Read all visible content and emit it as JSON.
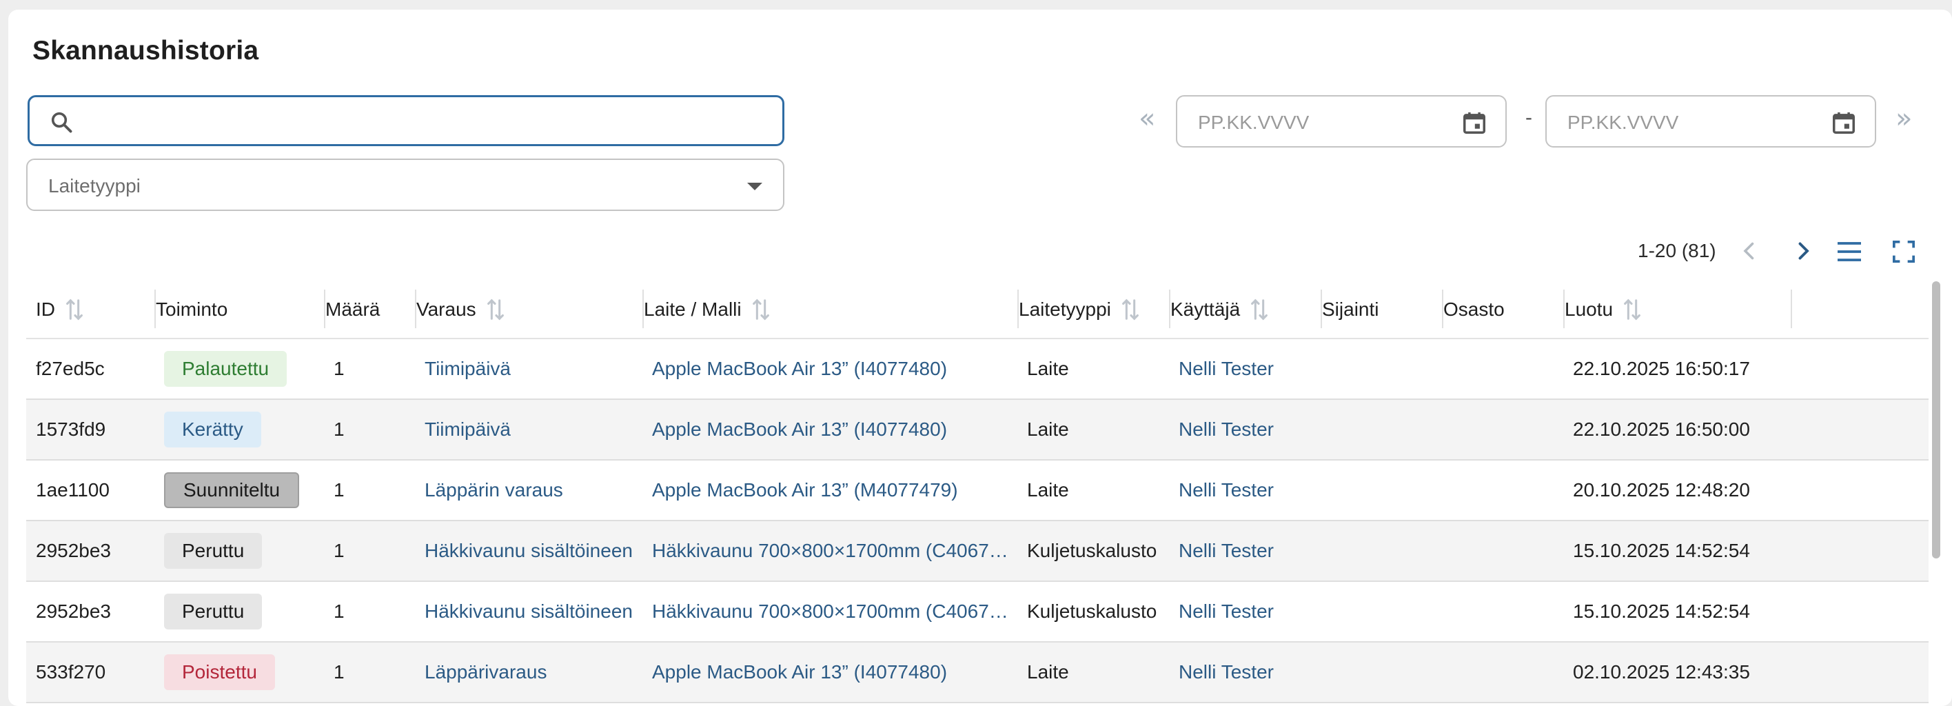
{
  "page": {
    "title": "Skannaushistoria"
  },
  "search": {
    "value": "",
    "placeholder": ""
  },
  "filter": {
    "device_type_label": "Laitetyyppi"
  },
  "dates": {
    "start_placeholder": "PP.KK.VVVV",
    "end_placeholder": "PP.KK.VVVV",
    "separator": "-",
    "prev_glyph": "«",
    "next_glyph": "»"
  },
  "pager": {
    "range_text": "1-20 (81)"
  },
  "table": {
    "headers": [
      "ID",
      "Toiminto",
      "Määrä",
      "Varaus",
      "Laite / Malli",
      "Laitetyyppi",
      "Käyttäjä",
      "Sijainti",
      "Osasto",
      "Luotu"
    ],
    "rows": [
      {
        "id": "f27ed5c",
        "action": "Palautettu",
        "action_kind": "palautettu",
        "qty": "1",
        "reservation": "Tiimipäivä",
        "device": "Apple MacBook Air 13” (I4077480)",
        "type": "Laite",
        "user": "Nelli Tester",
        "location": "",
        "dept": "",
        "created": "22.10.2025 16:50:17"
      },
      {
        "id": "1573fd9",
        "action": "Kerätty",
        "action_kind": "keratty",
        "qty": "1",
        "reservation": "Tiimipäivä",
        "device": "Apple MacBook Air 13” (I4077480)",
        "type": "Laite",
        "user": "Nelli Tester",
        "location": "",
        "dept": "",
        "created": "22.10.2025 16:50:00"
      },
      {
        "id": "1ae1100",
        "action": "Suunniteltu",
        "action_kind": "suunniteltu",
        "qty": "1",
        "reservation": "Läppärin varaus",
        "device": "Apple MacBook Air 13” (M4077479)",
        "type": "Laite",
        "user": "Nelli Tester",
        "location": "",
        "dept": "",
        "created": "20.10.2025 12:48:20"
      },
      {
        "id": "2952be3",
        "action": "Peruttu",
        "action_kind": "peruttu",
        "qty": "1",
        "reservation": "Häkkivaunu sisältöineen",
        "device": "Häkkivaunu 700×800×1700mm (C4067…",
        "type": "Kuljetuskalusto",
        "user": "Nelli Tester",
        "location": "",
        "dept": "",
        "created": "15.10.2025 14:52:54"
      },
      {
        "id": "2952be3",
        "action": "Peruttu",
        "action_kind": "peruttu",
        "qty": "1",
        "reservation": "Häkkivaunu sisältöineen",
        "device": "Häkkivaunu 700×800×1700mm (C4067…",
        "type": "Kuljetuskalusto",
        "user": "Nelli Tester",
        "location": "",
        "dept": "",
        "created": "15.10.2025 14:52:54"
      },
      {
        "id": "533f270",
        "action": "Poistettu",
        "action_kind": "poistettu",
        "qty": "1",
        "reservation": "Läppärivaraus",
        "device": "Apple MacBook Air 13” (I4077480)",
        "type": "Laite",
        "user": "Nelli Tester",
        "location": "",
        "dept": "",
        "created": "02.10.2025 12:43:35"
      }
    ]
  },
  "icons": {
    "search": "search-icon",
    "calendar": "calendar-icon",
    "sort": "sort-icon",
    "menu": "menu-icon",
    "fullscreen": "fullscreen-icon"
  },
  "colors": {
    "accent": "#2f6ca3",
    "link": "#2b5a85"
  }
}
